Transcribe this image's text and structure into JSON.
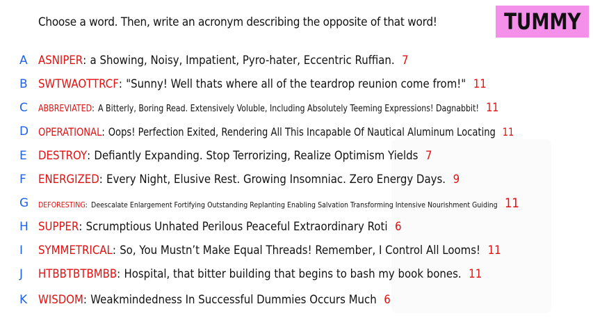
{
  "prompt": "Choose a word. Then, write an acronym describing the opposite of that word!",
  "word": "TUMMY",
  "accent_colors": {
    "letters": "#1f63e8",
    "acronyms": "#e21010",
    "badge": "#f490ea"
  },
  "entries": [
    {
      "letter": "A",
      "acronym": "ASNIPER",
      "definition": "a Showing, Noisy, Impatient, Pyro-hater, Eccentric Ruffian.",
      "count": "7"
    },
    {
      "letter": "B",
      "acronym": "SWTWAOTTRCF",
      "definition": "\"Sunny! Well thats where all of the teardrop reunion come from!\"",
      "count": "11"
    },
    {
      "letter": "C",
      "acronym": "ABBREVIATED",
      "definition": "A Bitterly, Boring Read. Extensively Voluble, Including Absolutely Teeming Expressions! Dagnabbit!",
      "count": "11"
    },
    {
      "letter": "D",
      "acronym": "OPERATIONAL",
      "definition": "Oops! Perfection Exited, Rendering All This Incapable Of Nautical Aluminum Locating",
      "count": "11"
    },
    {
      "letter": "E",
      "acronym": "DESTROY",
      "definition": "Defiantly Expanding. Stop Terrorizing, Realize Optimism Yields",
      "count": "7"
    },
    {
      "letter": "F",
      "acronym": "ENERGIZED",
      "definition": "Every Night, Elusive Rest. Growing Insomniac. Zero Energy Days.",
      "count": "9"
    },
    {
      "letter": "G",
      "acronym": "DEFORESTING",
      "definition": "Deescalate Enlargement Fortifying Outstanding Replanting Enabling Salvation Transforming Intensive Nourishment Guiding",
      "count": "11"
    },
    {
      "letter": "H",
      "acronym": "SUPPER",
      "definition": "Scrumptious Unhated Perilous Peaceful Extraordinary Roti",
      "count": "6"
    },
    {
      "letter": "I",
      "acronym": "SYMMETRICAL",
      "definition": "So, You Mustn’t Make Equal Threads! Remember, I Control All Looms!",
      "count": "11"
    },
    {
      "letter": "J",
      "acronym": "HTBBTBTBMBB",
      "definition": "Hospital, that bitter building that begins to bash my book bones.",
      "count": "11"
    },
    {
      "letter": "K",
      "acronym": "WISDOM",
      "definition": "Weakmindedness In Successful Dummies Occurs Much",
      "count": "6"
    }
  ]
}
